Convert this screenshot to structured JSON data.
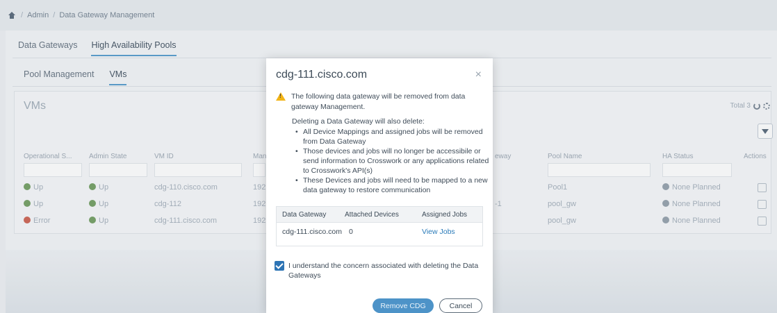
{
  "breadcrumb": {
    "items": [
      "Admin",
      "Data Gateway Management"
    ],
    "separator": "/"
  },
  "tabs_main": [
    {
      "label": "Data Gateways",
      "active": false
    },
    {
      "label": "High Availability Pools",
      "active": true
    }
  ],
  "tabs_sub": [
    {
      "label": "Pool Management",
      "active": false
    },
    {
      "label": "VMs",
      "active": true
    }
  ],
  "vms": {
    "title": "VMs",
    "total": "Total 3",
    "columns": [
      "Operational S...",
      "Admin State",
      "VM ID",
      "Man",
      "eway",
      "Pool Name",
      "HA Status",
      "Actions"
    ],
    "rows": [
      {
        "op_state": "Up",
        "admin_state": "Up",
        "vm_id": "cdg-110.cisco.com",
        "mgmt": "192",
        "gateway": "",
        "pool": "Pool1",
        "ha_status": "None Planned"
      },
      {
        "op_state": "Up",
        "admin_state": "Up",
        "vm_id": "cdg-112",
        "mgmt": "192",
        "gateway": "-1",
        "pool": "pool_gw",
        "ha_status": "None Planned"
      },
      {
        "op_state": "Error",
        "admin_state": "Up",
        "vm_id": "cdg-111.cisco.com",
        "mgmt": "192",
        "gateway": "",
        "pool": "pool_gw",
        "ha_status": "None Planned"
      }
    ]
  },
  "modal": {
    "title": "cdg-111.cisco.com",
    "close": "×",
    "warning": "The following data gateway will be removed from data gateway Management.",
    "delete_intro": "Deleting a Data Gateway will also delete:",
    "bullets": [
      "All Device Mappings and assigned jobs will be removed from Data Gateway",
      "Those devices and jobs will no longer be accessibile or send information to Crosswork or any applications related to Crosswork's API(s)",
      "These Devices and jobs will need to be mapped to a new data gateway to restore communication"
    ],
    "table": {
      "headers": [
        "Data Gateway",
        "Attached Devices",
        "Assigned Jobs"
      ],
      "row": {
        "gateway": "cdg-111.cisco.com",
        "devices": "0",
        "jobs": "View Jobs"
      }
    },
    "confirm": "I understand the concern associated with deleting the Data Gateways",
    "confirm_checked": true,
    "remove_label": "Remove CDG",
    "cancel_label": "Cancel"
  },
  "colors": {
    "accent": "#2d74b5",
    "primary_button": "#4d93c8",
    "warning": "#f2b416",
    "status_up": "#7aa36a",
    "status_error": "#d06a5a"
  }
}
